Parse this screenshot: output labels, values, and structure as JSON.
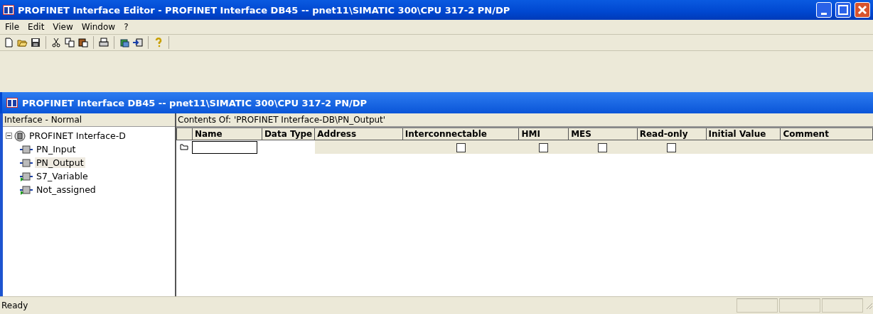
{
  "window": {
    "title": "PROFINET Interface Editor - PROFINET Interface DB45 -- pnet11\\SIMATIC 300\\CPU 317-2 PN/DP"
  },
  "menu": [
    "File",
    "Edit",
    "View",
    "Window",
    "?"
  ],
  "child_window": {
    "title": "PROFINET Interface DB45 -- pnet11\\SIMATIC 300\\CPU 317-2 PN/DP"
  },
  "tree": {
    "header": "Interface - Normal",
    "root": {
      "label": "PROFINET Interface-D",
      "expanded": true,
      "children": [
        {
          "label": "PN_Input",
          "selected": false
        },
        {
          "label": "PN_Output",
          "selected": true
        },
        {
          "label": "S7_Variable",
          "selected": false
        },
        {
          "label": "Not_assigned",
          "selected": false
        }
      ]
    }
  },
  "contents": {
    "header": "Contents Of: 'PROFINET Interface-DB\\PN_Output'",
    "columns": [
      "Name",
      "Data Type",
      "Address",
      "Interconnectable",
      "HMI",
      "MES",
      "Read-only",
      "Initial Value",
      "Comment"
    ],
    "rows": [
      {
        "interconnectable": false,
        "hmi": false,
        "mes": false,
        "read_only": false
      }
    ]
  },
  "status_bar": {
    "text": "Ready"
  }
}
